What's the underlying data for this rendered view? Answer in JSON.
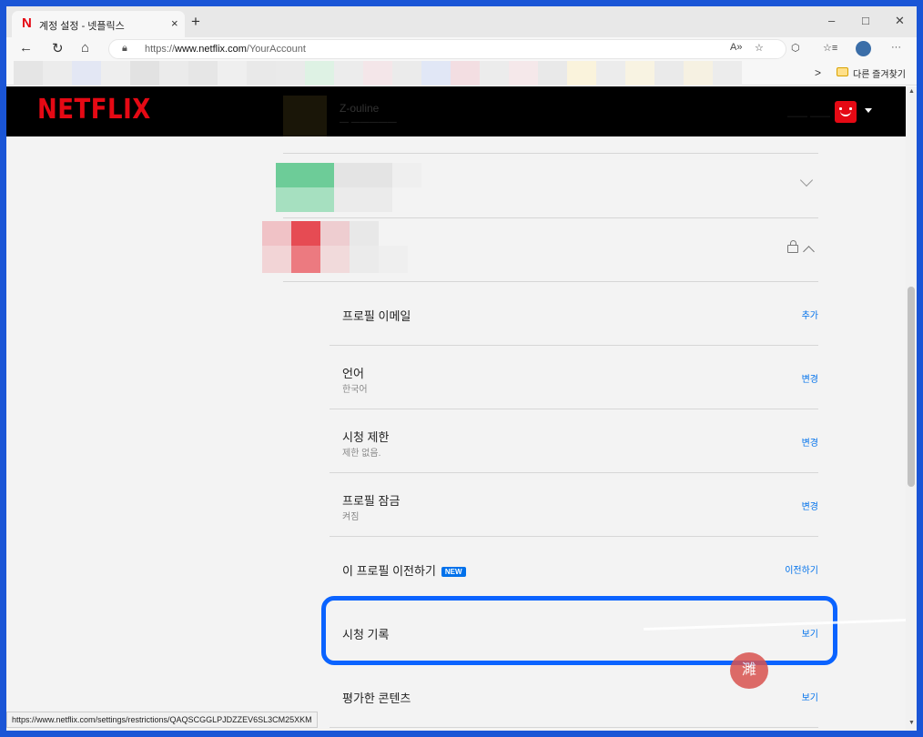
{
  "browser": {
    "tab_title": "계정 설정 - 넷플릭스",
    "tab_close": "×",
    "new_tab": "+",
    "minimize": "–",
    "maximize": "□",
    "close": "✕",
    "url_scheme": "https://",
    "url_domain": "www.netflix.com",
    "url_path": "/YourAccount",
    "favorites_folder": "다른 즐겨찾기",
    "status_url": "https://www.netflix.com/settings/restrictions/QAQSCGGLPJDZZEV6SL3CM25XKM"
  },
  "header": {
    "logo": "NETFLIX",
    "profile_name": "Z-ouline",
    "profile_sub": "— —————",
    "header_link": "—— ——"
  },
  "settings": [
    {
      "title": "프로필 이메일",
      "sub": "",
      "action": "추가"
    },
    {
      "title": "언어",
      "sub": "한국어",
      "action": "변경"
    },
    {
      "title": "시청 제한",
      "sub": "제한 없음.",
      "action": "변경"
    },
    {
      "title": "프로필 잠금",
      "sub": "켜짐",
      "action": "변경"
    },
    {
      "title": "이 프로필 이전하기",
      "sub": "",
      "action": "이전하기",
      "badge": "NEW"
    },
    {
      "title": "시청 기록",
      "sub": "",
      "action": "보기"
    },
    {
      "title": "평가한 콘텐츠",
      "sub": "",
      "action": "보기"
    }
  ],
  "watermark": {
    "stamp": "濉"
  },
  "colors": {
    "netflix_red": "#e50914",
    "link_blue": "#0071eb",
    "highlight": "#0a63ff"
  },
  "icons": [
    "back-icon",
    "refresh-icon",
    "home-icon",
    "lock-icon",
    "read-aloud-icon",
    "favorite-icon",
    "extensions-icon",
    "favorites-list-icon",
    "profile-icon",
    "more-icon"
  ]
}
